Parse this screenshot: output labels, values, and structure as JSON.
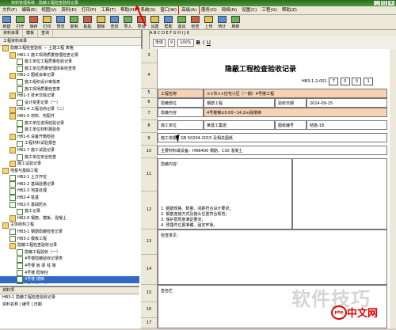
{
  "window": {
    "title": "资料管理系统 - 隐蔽工程检查验收记录",
    "min": "_",
    "max": "□",
    "close": "×"
  },
  "menu": [
    "文件(F)",
    "编辑(E)",
    "视图(V)",
    "资料(D)",
    "打印(P)",
    "工具(T)",
    "帮助(H)",
    "系统(S)",
    "窗口(W)",
    "高级(A)",
    "服务(O)",
    "网络(N)",
    "设置(C)",
    "工程(G)",
    "帮助(Z)"
  ],
  "menu_highlight_index": 9,
  "toolbar": [
    "新建",
    "打开",
    "保存",
    "打印",
    "预览",
    "复制",
    "粘贴",
    "删除",
    "查找",
    "导入",
    "导出",
    "设置",
    "帮助",
    "退出",
    "检查",
    "上传",
    "统计",
    "刷新"
  ],
  "left_tabs": [
    "资料目录",
    "模板",
    "查询"
  ],
  "left_subtitle": "工程资料目录",
  "tree": [
    {
      "label": "隐蔽工程检查验收 — 土建工程 表格",
      "indent": 0,
      "type": "fold"
    },
    {
      "label": "HB1-1 施工现场质量管理检查记录",
      "indent": 1,
      "type": "fold"
    },
    {
      "label": "施工单位工程质量检验记录",
      "indent": 2,
      "type": "doc"
    },
    {
      "label": "施工单位质量管理体系检查表",
      "indent": 2,
      "type": "doc"
    },
    {
      "label": "HB1-2 图纸会审记录",
      "indent": 1,
      "type": "fold"
    },
    {
      "label": "施工组织设计审批表",
      "indent": 2,
      "type": "doc"
    },
    {
      "label": "施工现场质量检查表",
      "indent": 2,
      "type": "doc"
    },
    {
      "label": "HB1-3 技术交底记录",
      "indent": 1,
      "type": "fold"
    },
    {
      "label": "设计变更记录（一）",
      "indent": 2,
      "type": "doc"
    },
    {
      "label": "HB1-4 工程洽商记录（二）",
      "indent": 1,
      "type": "fold"
    },
    {
      "label": "HB1-5 材料、构配件",
      "indent": 1,
      "type": "fold"
    },
    {
      "label": "施工单位进场检验记录",
      "indent": 2,
      "type": "doc"
    },
    {
      "label": "施工单位材料报验单",
      "indent": 2,
      "type": "doc"
    },
    {
      "label": "HB1-6 设备开箱检验",
      "indent": 1,
      "type": "fold"
    },
    {
      "label": "工程材料试验报告",
      "indent": 2,
      "type": "doc"
    },
    {
      "label": "HB1-7 施工试验记录",
      "indent": 1,
      "type": "fold"
    },
    {
      "label": "施工单位安全检查",
      "indent": 2,
      "type": "doc"
    },
    {
      "label": "施工试验记录",
      "indent": 1,
      "type": "fold"
    },
    {
      "label": "地基与基础工程",
      "indent": 0,
      "type": "fold"
    },
    {
      "label": "HB2-1 土方开挖",
      "indent": 1,
      "type": "doc"
    },
    {
      "label": "HB2-2 基础验槽记录",
      "indent": 1,
      "type": "doc"
    },
    {
      "label": "HB2-3 地基处理",
      "indent": 1,
      "type": "doc"
    },
    {
      "label": "HB2-4 桩基",
      "indent": 1,
      "type": "doc"
    },
    {
      "label": "HB2-5 基础防水",
      "indent": 1,
      "type": "doc"
    },
    {
      "label": "施工记录",
      "indent": 2,
      "type": "doc"
    },
    {
      "label": "HB2-6 钢筋、模板、混凝土",
      "indent": 1,
      "type": "fold"
    },
    {
      "label": "主体结构工程",
      "indent": 0,
      "type": "fold"
    },
    {
      "label": "HB3-1 钢筋隐蔽检查记录",
      "indent": 1,
      "type": "doc"
    },
    {
      "label": "HB3-2 模板工程",
      "indent": 1,
      "type": "doc"
    },
    {
      "label": "隐蔽工程检查验收记录",
      "indent": 1,
      "type": "fold"
    },
    {
      "label": "隐蔽工程验收（一）",
      "indent": 2,
      "type": "doc"
    },
    {
      "label": "4号楼隐蔽验收记录表",
      "indent": 2,
      "type": "doc"
    },
    {
      "label": "4号楼 板 梁 柱 墙",
      "indent": 2,
      "type": "doc"
    },
    {
      "label": "4号楼 框架柱",
      "indent": 2,
      "type": "doc"
    },
    {
      "label": "4号楼 楼梯 ",
      "indent": 2,
      "type": "doc",
      "selected": true
    },
    {
      "label": "4号楼屋面 防水",
      "indent": 2,
      "type": "doc"
    },
    {
      "label": "4号楼屋面 4.5m梁板",
      "indent": 2,
      "type": "doc"
    },
    {
      "label": "4号楼屋面 女儿墙",
      "indent": 2,
      "type": "doc"
    },
    {
      "label": "4号楼地面层",
      "indent": 2,
      "type": "doc"
    },
    {
      "label": "4号楼 二层 梁板柱",
      "indent": 2,
      "type": "doc"
    }
  ],
  "left_bottom": {
    "bar": "资料项",
    "rows": [
      "HB3-1 隐蔽工程检查验收记录",
      "资料名称 | 编号 | 日期"
    ]
  },
  "ruler": "A    B    C    D    E    F    G    H    I    J    K",
  "form_toolbar": {
    "font": "宋体",
    "size": "9",
    "zoom": "100%"
  },
  "row_numbers": [
    "3",
    "4",
    "5",
    "6",
    "7",
    "8",
    "9",
    "10",
    "11",
    "12",
    "13",
    "14",
    "15",
    "16",
    "17"
  ],
  "sheet": {
    "title": "隐蔽工程检查验收记录",
    "code_label": "HB3-1-2-001",
    "code_boxes": [
      "7",
      "0",
      "0",
      "1"
    ],
    "rows": [
      {
        "label": "工程名称",
        "value": "××市××住宅小区（一期）4号楼工程"
      },
      {
        "label": "隐蔽部位",
        "value": "钢筋工程",
        "label2": "验收日期",
        "value2": "2014-09-15"
      },
      {
        "label": "隐蔽内容",
        "value": "4号楼梯±0.00~14.2m段楼梯"
      },
      {
        "label": "施工单位",
        "value": "某建工集团",
        "label2": "图纸编号",
        "value2": "结施-18"
      },
      {
        "label": "施工依据",
        "value": "GB 50204-2015 及相关图纸"
      },
      {
        "label": "主要材料或设备",
        "value": "HRB400 钢筋、C30 混凝土"
      }
    ],
    "content_label": "隐蔽内容：",
    "content_lines": [
      "1. 钢筋规格、数量、间距符合设计要求；",
      "2. 钢筋连接方式及接头位置符合规范；",
      "3. 保护层厚度满足要求；",
      "4. 预埋件位置准确、固定牢靠。"
    ],
    "check_label": "检查意见：",
    "sign_label": "签名栏"
  },
  "watermark": {
    "text": "软件技巧",
    "site": "中文网",
    "logo": "php"
  }
}
